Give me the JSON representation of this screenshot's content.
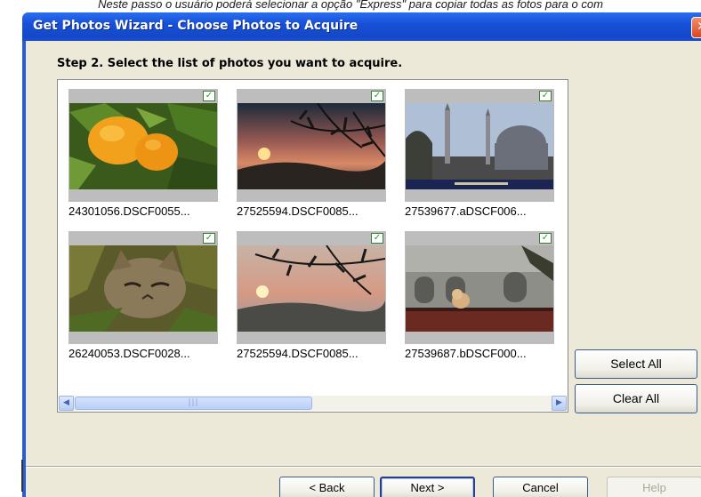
{
  "caption": "Neste passo o usuário poderá selecionar a opção \"Express\" para copiar todas as fotos para o com",
  "window": {
    "title": "Get Photos Wizard - Choose Photos to Acquire",
    "close_glyph": "✕"
  },
  "step_text": "Step 2. Select the list of photos you want to acquire.",
  "photos": [
    {
      "label": "24301056.DSCF0055...",
      "checked": true,
      "image": "oranges"
    },
    {
      "label": "27525594.DSCF0085...",
      "checked": true,
      "image": "sunset-branches"
    },
    {
      "label": "27539677.aDSCF006...",
      "checked": true,
      "image": "mosque"
    },
    {
      "label": "26240053.DSCF0028...",
      "checked": true,
      "image": "cat"
    },
    {
      "label": "27525594.DSCF0085...",
      "checked": true,
      "image": "sunset-branches"
    },
    {
      "label": "27539687.bDSCF000...",
      "checked": true,
      "image": "dog-building"
    }
  ],
  "check_glyph": "✓",
  "scrollbar": {
    "left_arrow": "◀",
    "right_arrow": "▶",
    "thumb_grip": "|||"
  },
  "side_buttons": {
    "select_all": "Select All",
    "clear_all": "Clear All"
  },
  "footer_buttons": {
    "back": "< Back",
    "next": "Next >",
    "cancel": "Cancel",
    "help": "Help"
  },
  "colors": {
    "titlebar": "#1750d8",
    "dialog_face": "#ece9d8",
    "check": "#2f9a2f"
  }
}
